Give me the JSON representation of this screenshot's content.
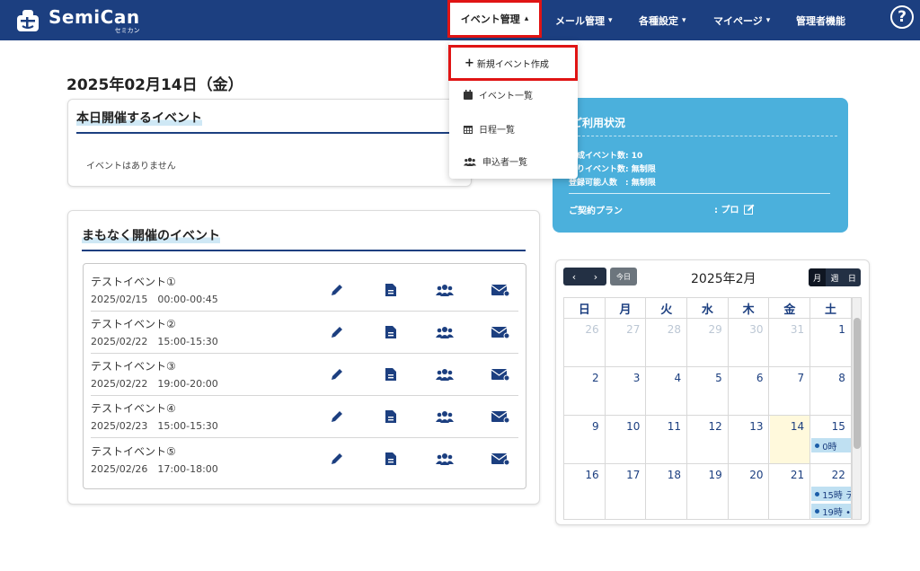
{
  "app": {
    "logo_text": "SemiCan",
    "logo_sub": "セミカン"
  },
  "nav": {
    "items": [
      {
        "label": "イベント管理"
      },
      {
        "label": "メール管理"
      },
      {
        "label": "各種設定"
      },
      {
        "label": "マイページ"
      },
      {
        "label": "管理者機能"
      }
    ],
    "help": "?"
  },
  "dropdown": {
    "items": [
      {
        "label": "新規イベント作成",
        "icon": "plus-icon"
      },
      {
        "label": "イベント一覧",
        "icon": "calendar-icon"
      },
      {
        "label": "日程一覧",
        "icon": "calendar-grid-icon"
      },
      {
        "label": "申込者一覧",
        "icon": "users-icon"
      }
    ]
  },
  "page": {
    "date_title": "2025年02月14日（金）"
  },
  "today": {
    "title": "本日開催するイベント",
    "empty": "イベントはありません"
  },
  "upcoming": {
    "title": "まもなく開催のイベント",
    "events": [
      {
        "name": "テストイベント①",
        "time": "2025/02/15　00:00-00:45"
      },
      {
        "name": "テストイベント②",
        "time": "2025/02/22　15:00-15:30"
      },
      {
        "name": "テストイベント③",
        "time": "2025/02/22　19:00-20:00"
      },
      {
        "name": "テストイベント④",
        "time": "2025/02/23　15:00-15:30"
      },
      {
        "name": "テストイベント⑤",
        "time": "2025/02/26　17:00-18:00"
      }
    ]
  },
  "usage": {
    "title": "ご利用状況",
    "lines": [
      "作成イベント数: 10",
      "残りイベント数: 無制限",
      "登録可能人数　: 無制限"
    ],
    "plan_label": "ご契約プラン",
    "plan_value": ": プロ"
  },
  "calendar": {
    "title": "2025年2月",
    "today_label": "今日",
    "prev": "‹",
    "next": "›",
    "views": [
      "月",
      "週",
      "日"
    ],
    "weekdays": [
      "日",
      "月",
      "火",
      "水",
      "木",
      "金",
      "土"
    ],
    "weeks": [
      [
        "26",
        "27",
        "28",
        "29",
        "30",
        "31",
        "1"
      ],
      [
        "2",
        "3",
        "4",
        "5",
        "6",
        "7",
        "8"
      ],
      [
        "9",
        "10",
        "11",
        "12",
        "13",
        "14",
        "15"
      ],
      [
        "16",
        "17",
        "18",
        "19",
        "20",
        "21",
        "22"
      ]
    ],
    "events": [
      {
        "label": "0時"
      },
      {
        "label": "15時 テ"
      },
      {
        "label": "19時 •"
      }
    ],
    "colors": {
      "accent": "#1c3f80",
      "today_bg": "#fff9dc",
      "event_bg": "#bfe0f2"
    }
  },
  "colors": {
    "header": "#1c3f80",
    "usage_bg": "#4bb0dc",
    "highlight": "#e01414"
  }
}
